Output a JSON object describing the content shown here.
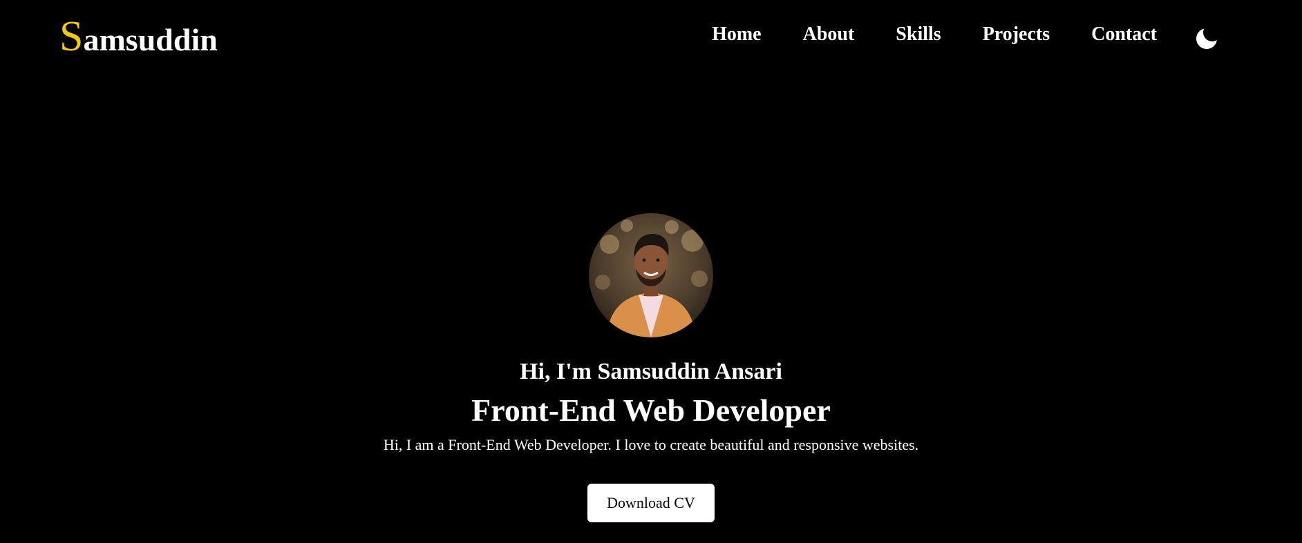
{
  "brand": {
    "initial": "S",
    "rest": "amsuddin",
    "initial_color": "#f2c811"
  },
  "nav": {
    "items": [
      {
        "label": "Home"
      },
      {
        "label": "About"
      },
      {
        "label": "Skills"
      },
      {
        "label": "Projects"
      },
      {
        "label": "Contact"
      }
    ],
    "theme_toggle_icon": "moon-icon"
  },
  "hero": {
    "avatar_icon": "profile-photo",
    "greeting": "Hi, I'm Samsuddin Ansari",
    "role": "Front-End Web Developer",
    "tagline": "Hi, I am a Front-End Web Developer. I love to create beautiful and responsive websites.",
    "cv_button_label": "Download CV"
  },
  "colors": {
    "background": "#000000",
    "text": "#ffffff",
    "accent": "#f2c811",
    "button_bg": "#ffffff",
    "button_text": "#000000"
  }
}
